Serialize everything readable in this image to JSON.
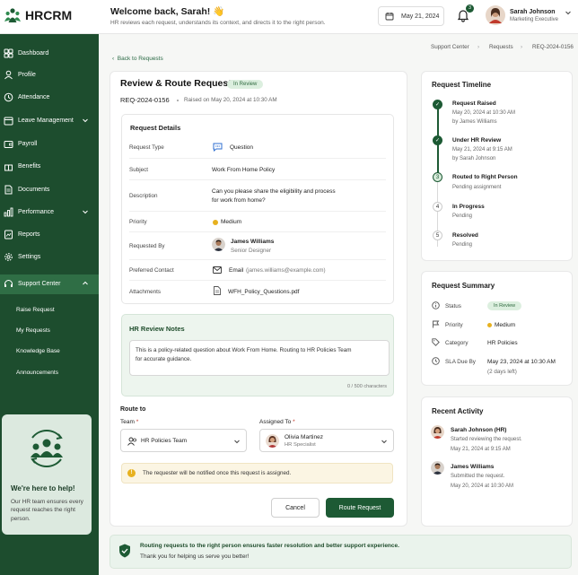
{
  "app": {
    "name": "HRCRM"
  },
  "header": {
    "welcome": "Welcome back, Sarah! 👋",
    "subtitle": "HR reviews each request, understands its context, and directs it to the right person.",
    "date": "May 21, 2024",
    "notification_count": "3",
    "user_name": "Sarah Johnson",
    "user_role": "Marketing Executive"
  },
  "sidebar": {
    "items": [
      {
        "label": "Dashboard",
        "icon": "grid-icon"
      },
      {
        "label": "Profile",
        "icon": "user-icon"
      },
      {
        "label": "Attendance",
        "icon": "clock-icon"
      },
      {
        "label": "Leave Management",
        "icon": "calendar-icon"
      },
      {
        "label": "Payroll",
        "icon": "wallet-icon"
      },
      {
        "label": "Benefits",
        "icon": "gift-icon"
      },
      {
        "label": "Documents",
        "icon": "document-icon"
      },
      {
        "label": "Performance",
        "icon": "chart-icon"
      },
      {
        "label": "Reports",
        "icon": "report-icon"
      },
      {
        "label": "Settings",
        "icon": "gear-icon"
      },
      {
        "label": "Support Center",
        "icon": "headset-icon"
      }
    ],
    "subitems": [
      "Raise Request",
      "My Requests",
      "Knowledge Base",
      "Announcements"
    ],
    "help_title": "We're here to help!",
    "help_text": "Our HR team ensures every request reaches the right person."
  },
  "breadcrumb": [
    "Support Center",
    "Requests",
    "REQ-2024-0156"
  ],
  "request": {
    "back": "Back to Requests",
    "title": "Review & Route Request",
    "status": "In Review",
    "id": "REQ-2024-0156",
    "raised": "Raised on May 20, 2024 at 10:30 AM",
    "details_title": "Request Details",
    "fields": {
      "type_label": "Request Type",
      "type": "Question",
      "subject_label": "Subject",
      "subject": "Work From Home Policy",
      "desc_label": "Description",
      "desc_1": "Can you please share the eligibility and process",
      "desc_2": "for work from home?",
      "priority_label": "Priority",
      "priority": "Medium",
      "by_label": "Requested By",
      "by_name": "James Williams",
      "by_role": "Senior Designer",
      "contact_label": "Preferred Contact",
      "contact": "Email",
      "email": "(james.williams@example.com)",
      "attach_label": "Attachments",
      "attachment": "WFH_Policy_Questions.pdf"
    },
    "notes_title": "HR Review Notes",
    "notes_1": "This is a policy-related question about Work From Home. Routing to HR Policies Team",
    "notes_2": "for accurate guidance.",
    "notes_count": "0 / 500 characters",
    "route_to": "Route to",
    "team_label": "Team",
    "team": "HR Policies Team",
    "assigned_label": "Assigned To",
    "assignee_name": "Olivia Martinez",
    "assignee_role": "HR Specialist",
    "notice": "The requester will be notified once this request is assigned.",
    "cancel": "Cancel",
    "submit": "Route Request"
  },
  "timeline": {
    "title": "Request Timeline",
    "steps": [
      {
        "mark": "✓",
        "title": "Request Raised",
        "l1": "May 20, 2024 at 10:30 AM",
        "l2": "by James Williams"
      },
      {
        "mark": "✓",
        "title": "Under HR Review",
        "l1": "May 21, 2024 at 9:15 AM",
        "l2": "by Sarah Johnson"
      },
      {
        "mark": "3",
        "title": "Routed to Right Person",
        "l1": "Pending assignment"
      },
      {
        "mark": "4",
        "title": "In Progress",
        "l1": "Pending"
      },
      {
        "mark": "5",
        "title": "Resolved",
        "l1": "Pending"
      }
    ]
  },
  "summary": {
    "title": "Request Summary",
    "status_label": "Status",
    "status": "In Review",
    "priority_label": "Priority",
    "priority": "Medium",
    "category_label": "Category",
    "category": "HR Policies",
    "sla_label": "SLA Due By",
    "sla_1": "May 23, 2024 at 10:30 AM",
    "sla_2": "(2 days left)"
  },
  "activity": {
    "title": "Recent Activity",
    "items": [
      {
        "name": "Sarah Johnson (HR)",
        "action": "Started reviewing the request.",
        "time": "May 21, 2024 at 9:15 AM"
      },
      {
        "name": "James Williams",
        "action": "Submitted the request.",
        "time": "May 20, 2024 at 10:30 AM"
      }
    ]
  },
  "footer": {
    "line1": "Routing requests to the right person ensures faster resolution and better support experience.",
    "line2": "Thank you for helping us serve you better!"
  },
  "colors": {
    "brand": "#1d4d2e",
    "accent": "#1d5a34",
    "warning": "#e7b11f"
  }
}
